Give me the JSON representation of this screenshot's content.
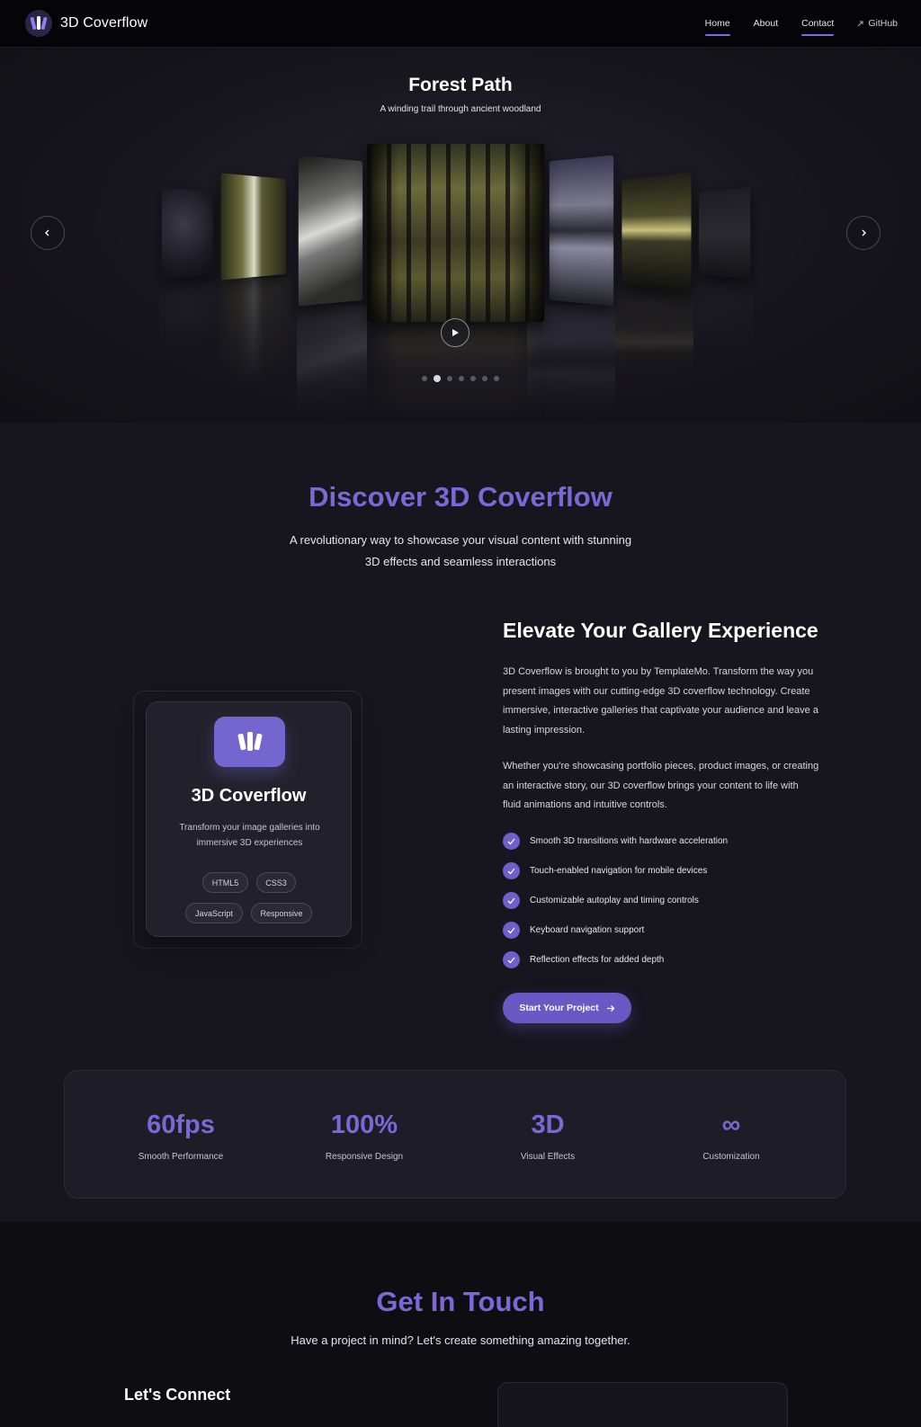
{
  "nav": {
    "brand": "3D Coverflow",
    "links": [
      {
        "label": "Home"
      },
      {
        "label": "About"
      },
      {
        "label": "Contact"
      },
      {
        "label": "GitHub"
      }
    ]
  },
  "hero": {
    "title": "Forest Path",
    "subtitle": "A winding trail through ancient woodland",
    "slide_count": 7,
    "active_slide": 2
  },
  "discover": {
    "title": "Discover 3D Coverflow",
    "subtitle_line1": "A revolutionary way to showcase your visual content with stunning",
    "subtitle_line2": "3D effects and seamless interactions"
  },
  "feature_card": {
    "title": "3D Coverflow",
    "desc_line1": "Transform your image galleries into",
    "desc_line2": "immersive 3D experiences",
    "tags": [
      "HTML5",
      "CSS3",
      "JavaScript",
      "Responsive"
    ]
  },
  "elevate": {
    "title": "Elevate Your Gallery Experience",
    "p1_lines": [
      "3D Coverflow is brought to you by TemplateMo. Transform the way you",
      "present images with our cutting-edge 3D coverflow technology. Create",
      "immersive, interactive galleries that captivate your audience and leave a",
      "lasting impression."
    ],
    "p2_lines": [
      "Whether you're showcasing portfolio pieces, product images, or creating",
      "an interactive story, our 3D coverflow brings your content to life with",
      "fluid animations and intuitive controls."
    ],
    "features": [
      "Smooth 3D transitions with hardware acceleration",
      "Touch-enabled navigation for mobile devices",
      "Customizable autoplay and timing controls",
      "Keyboard navigation support",
      "Reflection effects for added depth"
    ],
    "cta": "Start Your Project"
  },
  "stats": [
    {
      "value": "60fps",
      "label": "Smooth Performance"
    },
    {
      "value": "100%",
      "label": "Responsive Design"
    },
    {
      "value": "3D",
      "label": "Visual Effects"
    },
    {
      "value": "∞",
      "label": "Customization"
    }
  ],
  "contact": {
    "title": "Get In Touch",
    "subtitle": "Have a project in mind? Let's create something amazing together.",
    "lets_connect": "Let's Connect"
  },
  "colors": {
    "accent": "#7b68d4",
    "button": "#6a59c4",
    "background": "#17161f"
  }
}
